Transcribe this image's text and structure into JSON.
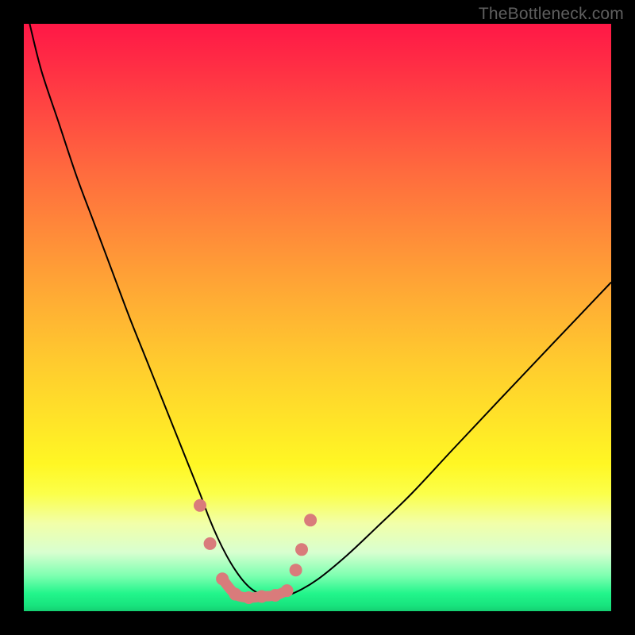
{
  "watermark": "TheBottleneck.com",
  "chart_data": {
    "type": "line",
    "title": "",
    "xlabel": "",
    "ylabel": "",
    "xlim": [
      0,
      100
    ],
    "ylim": [
      0,
      100
    ],
    "series": [
      {
        "name": "bottleneck-curve",
        "x": [
          1,
          3,
          6,
          9,
          12,
          15,
          18,
          21,
          24,
          26,
          28,
          30,
          31.5,
          33,
          34.5,
          36,
          37.5,
          39,
          41,
          43,
          46,
          50,
          55,
          60,
          66,
          73,
          81,
          90,
          100
        ],
        "y": [
          100,
          92,
          83,
          74,
          66,
          58,
          50,
          42.5,
          35,
          30,
          25,
          20,
          16,
          12.5,
          9.5,
          7,
          5,
          3.6,
          2.6,
          2.3,
          3.1,
          5.4,
          9.5,
          14.2,
          20,
          27.5,
          36,
          45.5,
          56
        ]
      }
    ],
    "markers": {
      "name": "highlight-dots",
      "color": "#d97b7b",
      "points": [
        {
          "x": 30.0,
          "y": 18.0
        },
        {
          "x": 31.7,
          "y": 11.5
        },
        {
          "x": 33.8,
          "y": 5.5
        },
        {
          "x": 36.0,
          "y": 2.9
        },
        {
          "x": 38.3,
          "y": 2.3
        },
        {
          "x": 40.5,
          "y": 2.5
        },
        {
          "x": 42.8,
          "y": 2.7
        },
        {
          "x": 44.8,
          "y": 3.5
        },
        {
          "x": 46.3,
          "y": 7.0
        },
        {
          "x": 47.3,
          "y": 10.5
        },
        {
          "x": 48.8,
          "y": 15.5
        }
      ],
      "thick_segment": {
        "from_idx": 2,
        "to_idx": 7
      }
    },
    "colors": {
      "gradient_top": "#ff1846",
      "gradient_mid": "#ffe528",
      "gradient_bottom": "#15cf72",
      "curve": "#000000",
      "markers": "#d97b7b"
    }
  }
}
